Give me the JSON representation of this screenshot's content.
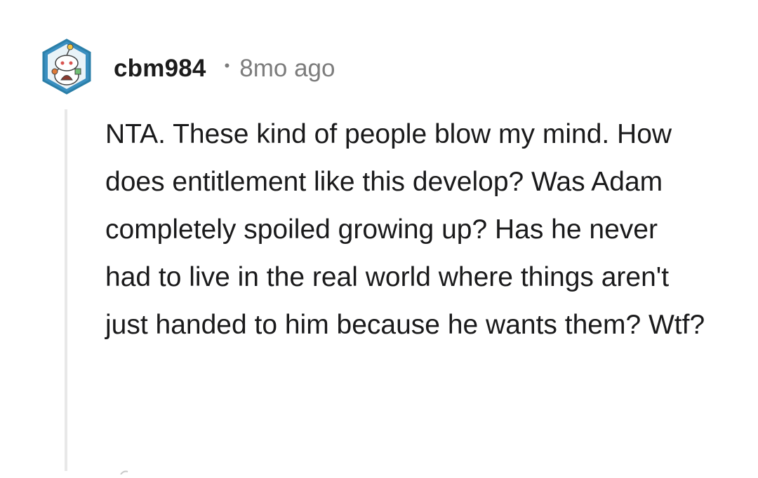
{
  "comment": {
    "username": "cbm984",
    "separator": "•",
    "timestamp": "8mo ago",
    "body": "NTA. These kind of people blow my mind. How does entitlement like this develop? Was Adam completely spoiled growing up? Has he never had to live in the real world where things aren't just handed to him because he wants them? Wtf?"
  },
  "icons": {
    "avatar": "reddit-snoo-avatar-icon"
  },
  "colors": {
    "username": "#1c1c1c",
    "meta": "#7c7c7c",
    "thread_line": "#e8e8e8",
    "avatar_border": "#2b7fa8"
  }
}
